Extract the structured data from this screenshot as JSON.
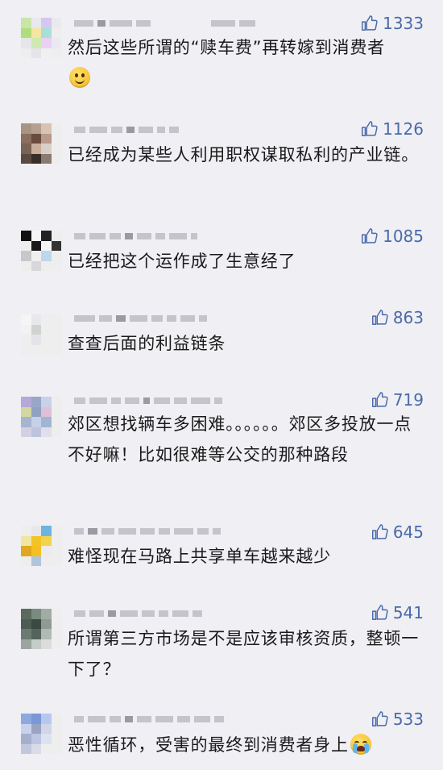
{
  "comments": [
    {
      "likes": "1333",
      "text": "然后这些所谓的“赎车费”再转嫁到消费者",
      "emoji": "smile-emoji"
    },
    {
      "likes": "1126",
      "text": "已经成为某些人利用职权谋取私利的产业链。"
    },
    {
      "likes": "1085",
      "text": "已经把这个运作成了生意经了"
    },
    {
      "likes": "863",
      "text": "查查后面的利益链条"
    },
    {
      "likes": "719",
      "text": "郊区想找辆车多困难。。。。。。郊区多投放一点不好嘛！比如很难等公交的那种路段"
    },
    {
      "likes": "645",
      "text": "难怪现在马路上共享单车越来越少"
    },
    {
      "likes": "541",
      "text": "所谓第三方市场是不是应该审核资质，整顿一下了？"
    },
    {
      "likes": "533",
      "text": "恶性循环，受害的最终到消费者身上",
      "emoji": "crying-emoji"
    }
  ],
  "icons": {
    "like": "thumbs-up-icon"
  },
  "colors": {
    "background": "#efeff4",
    "like": "#4a6aa8",
    "text": "#1a1a1a"
  }
}
